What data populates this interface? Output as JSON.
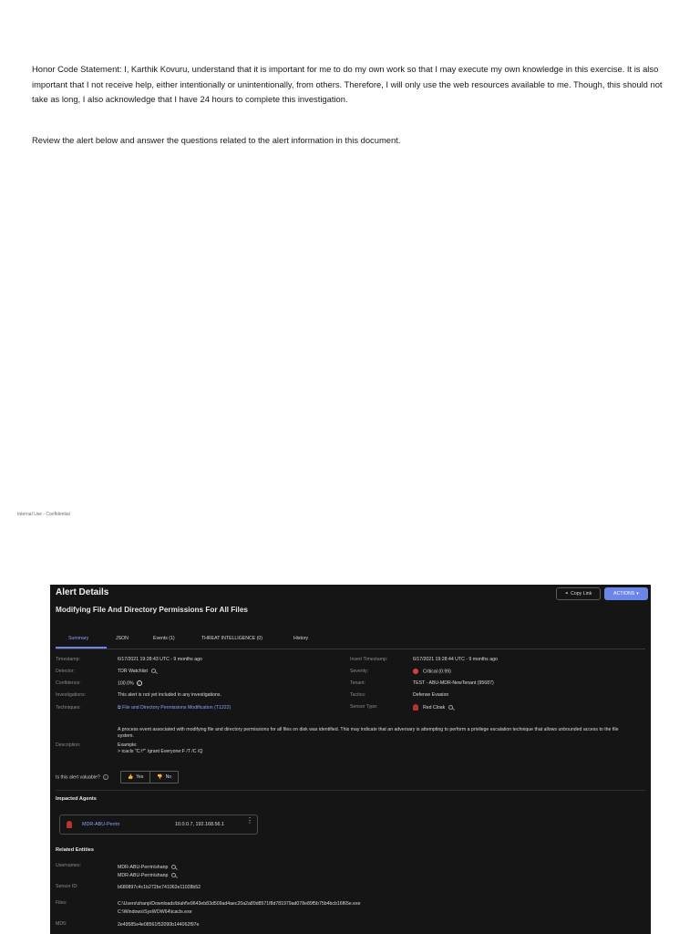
{
  "document": {
    "honor_statement": "Honor Code Statement: I, Karthik Kovuru, understand that it is important for me to do my own work so that I may execute my own knowledge in this exercise. It is also important that I not receive help, either intentionally or unintentionally, from others. Therefore, I will only use the web resources available to me. Though, this should not take as long, I also acknowledge that I have 24 hours to complete this investigation.",
    "review_instruction": "Review the alert below and answer the questions related to the alert information in this document.",
    "footer": "Internal Use - Confidential"
  },
  "alert": {
    "header": "Alert Details",
    "title": "Modifying File And Directory Permissions For All Files",
    "copy_link": "Copy Link",
    "actions": "ACTIONS",
    "tabs": [
      {
        "label": "Summary",
        "active": true
      },
      {
        "label": "JSON"
      },
      {
        "label": "Events (1)"
      },
      {
        "label": "THREAT INTELLIGENCE (0)"
      },
      {
        "label": "History"
      }
    ],
    "left_fields": [
      {
        "label": "Timestamp:",
        "value": "6/17/2021 19:28:43 UTC - 9 months ago"
      },
      {
        "label": "Detector:",
        "value": "TDR Watchlist"
      },
      {
        "label": "Confidence:",
        "value": "100.0%"
      },
      {
        "label": "Investigations:",
        "value": "This alert is not yet included in any investigations."
      },
      {
        "label": "Techniques:",
        "value": "File and Directory Permissions Modification (T1222)"
      }
    ],
    "right_fields": [
      {
        "label": "Insert Timestamp:",
        "value": "6/17/2021 19:28:44 UTC - 9 months ago"
      },
      {
        "label": "Severity:",
        "value": "Critical (0.99)"
      },
      {
        "label": "Tenant:",
        "value": "TEST - ABU-MDR-NewTenant (95687)"
      },
      {
        "label": "Tactics:",
        "value": "Defense Evasion"
      },
      {
        "label": "Sensor Type:",
        "value": "Red Cloak"
      }
    ],
    "description_label": "Description:",
    "description": "A process event associated with modifying file and directory permissions for all files on disk was identified. This may indicate that an adversary is attempting to perform a privilege escalation technique that allows unbounded access to the file system.",
    "example_label": "Example:",
    "example": "> icacls \"C:\\*\" /grant Everyone:F /T /C /Q",
    "valuable_label": "Is this alert valuable?",
    "yes": "Yes",
    "no": "No",
    "impacted_agents_heading": "Impacted Agents",
    "agent": {
      "name": "MDR-ABU-Perrin",
      "ips": "10.0.0.7, 192.168.56.1"
    },
    "related_entities_heading": "Related Entities",
    "entities": {
      "usernames_label": "Usernames:",
      "usernames": [
        "MDR-ABU-Perrin\\shanp",
        "MDR-ABU-Perrin\\shanp"
      ],
      "sensor_id_label": "Sensor ID:",
      "sensor_id": "b680897c4c1b272bc741062e11028b52",
      "files_label": "Files:",
      "files": [
        "C:\\Users\\shanp\\Downloads\\blahf\\e9643eb83d509ad4aec20a2a89d8571f8d781979ad078e89f5b75b4bcb16f65e.exe",
        "C:\\Windows\\SysWOW64\\icacls.exe"
      ],
      "md5_label": "MD5:",
      "md5": "2e49585e4e08561f52090b144062f97e"
    }
  }
}
